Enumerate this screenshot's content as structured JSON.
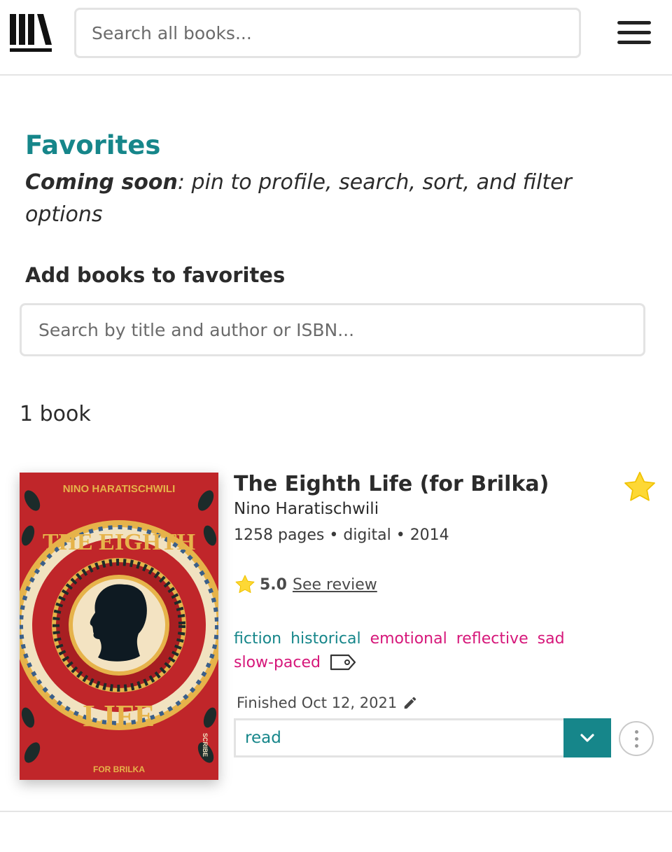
{
  "header": {
    "search_placeholder": "Search all books...",
    "logo_icon": "storygraph-books-logo-icon",
    "menu_icon": "hamburger-menu-icon"
  },
  "page": {
    "title": "Favorites",
    "coming_soon_label": "Coming soon",
    "coming_soon_text": ": pin to profile, search, sort, and filter options",
    "add_heading": "Add books to favorites",
    "add_search_placeholder": "Search by title and author or ISBN...",
    "count_text": "1 book"
  },
  "book": {
    "title": "The Eighth Life (for Brilka)",
    "author": "Nino Haratischwili",
    "meta": "1258 pages • digital • 2014",
    "rating": "5.0",
    "rating_stars": 1,
    "see_review": "See review",
    "tags": [
      {
        "label": "fiction",
        "kind": "genre"
      },
      {
        "label": "historical",
        "kind": "genre"
      },
      {
        "label": "emotional",
        "kind": "mood"
      },
      {
        "label": "reflective",
        "kind": "mood"
      },
      {
        "label": "sad",
        "kind": "mood"
      },
      {
        "label": "slow-paced",
        "kind": "mood"
      }
    ],
    "finished": "Finished Oct 12, 2021",
    "status": "read",
    "cover": {
      "author_text": "NINO HARATISCHWILI",
      "title_top": "THE EIGHTH",
      "title_bottom": "LIFE",
      "subtitle": "FOR BRILKA",
      "publisher": "SCRIBE"
    }
  },
  "colors": {
    "accent": "#16868a",
    "mood": "#d6177a",
    "star": "#fdd835",
    "cover_red": "#c0262a",
    "cover_gold": "#e6b34a"
  }
}
